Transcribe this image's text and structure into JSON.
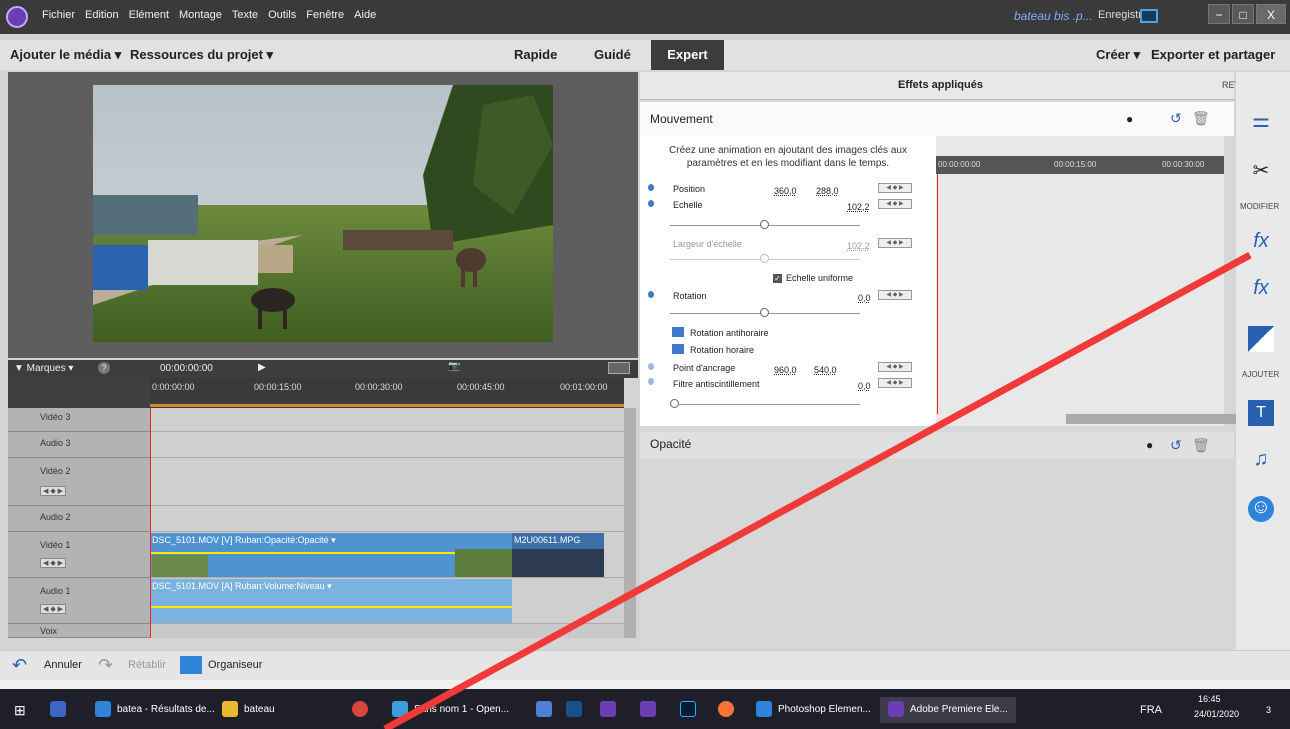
{
  "menu": {
    "items": [
      "Fichier",
      "Edition",
      "Elément",
      "Montage",
      "Texte",
      "Outils",
      "Fenêtre",
      "Aide"
    ]
  },
  "titlebar": {
    "doc_title": "bateau bis .p...",
    "save": "Enregistrer",
    "minimize": "−",
    "maximize": "□",
    "close": "X"
  },
  "toolbar": {
    "add_media": "Ajouter le média ▾",
    "resources": "Ressources du projet ▾",
    "mode_quick": "Rapide",
    "mode_guided": "Guidé",
    "mode_expert": "Expert",
    "create": "Créer ▾",
    "export": "Exporter et partager"
  },
  "transport": {
    "markers": "▼ Marques ▾",
    "help": "?",
    "timecode": "00:00:00:00"
  },
  "timeline": {
    "ruler": [
      "0:00:00:00",
      "00:00:15:00",
      "00:00:30:00",
      "00:00:45:00",
      "00:01:00:00"
    ],
    "tracks": [
      "Vidéo 3",
      "Audio 3",
      "Vidéo 2",
      "Audio 2",
      "Vidéo 1",
      "Audio 1",
      "Voix"
    ],
    "clip_video": "DSC_5101.MOV [V] Ruban:Opacité:Opacité ▾",
    "clip_video2": "M2U00611.MPG",
    "clip_audio": "DSC_5101.MOV [A] Ruban:Volume:Niveau ▾"
  },
  "effects": {
    "header": "Effets appliqués",
    "retouche": "RETOUCHE",
    "mouvement": "Mouvement",
    "hint": "Créez une animation en ajoutant des images clés aux paramètres et en les modifiant dans le temps.",
    "kf_ruler": [
      "00:00:00:00",
      "00:00:15:00",
      "00:00:30:00"
    ],
    "position_label": "Position",
    "position_x": "360,0",
    "position_y": "288,0",
    "echelle_label": "Echelle",
    "echelle_val": "102,2",
    "largeur_label": "Largeur d'échelle",
    "largeur_val": "102,2",
    "uniforme": "Echelle uniforme",
    "rotation_label": "Rotation",
    "rotation_val": "0,0",
    "rot_anti": "Rotation antihoraire",
    "rot_hor": "Rotation horaire",
    "ancrage_label": "Point d'ancrage",
    "ancrage_x": "960,0",
    "ancrage_y": "540,0",
    "filtre_label": "Filtre antiscintillement",
    "filtre_val": "0,0",
    "opacite": "Opacité"
  },
  "sidebar": {
    "modifier": "MODIFIER",
    "ajouter": "AJOUTER"
  },
  "bottom": {
    "undo": "Annuler",
    "redo": "Rétablir",
    "organizer": "Organiseur"
  },
  "taskbar": {
    "apps": [
      "batea - Résultats de...",
      "bateau",
      "Sans nom 1 - Open...",
      "Photoshop Elemen...",
      "Adobe Premiere Ele..."
    ],
    "lang": "FRA",
    "time": "16:45",
    "date": "24/01/2020",
    "notif": "3"
  }
}
